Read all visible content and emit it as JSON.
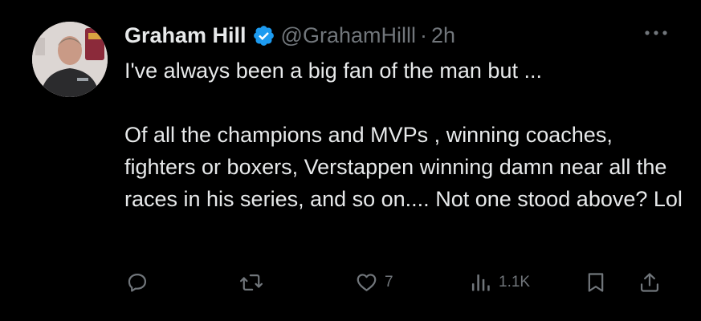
{
  "tweet": {
    "author": {
      "display_name": "Graham Hill",
      "handle": "@GrahamHilll",
      "verified": true
    },
    "separator": "·",
    "timestamp": "2h",
    "text": "I've always been a big fan of the man but ...\n\nOf all the champions and MVPs , winning coaches,  fighters or boxers, Verstappen winning damn near all the races in his series, and so on.... Not one stood above?  Lol",
    "actions": {
      "reply": {
        "icon": "reply-icon",
        "count": ""
      },
      "retweet": {
        "icon": "retweet-icon",
        "count": ""
      },
      "like": {
        "icon": "heart-icon",
        "count": "7"
      },
      "views": {
        "icon": "views-bar-chart-icon",
        "count": "1.1K"
      },
      "bookmark": {
        "icon": "bookmark-icon"
      },
      "share": {
        "icon": "share-icon"
      }
    }
  },
  "colors": {
    "background": "#000000",
    "primary_text": "#e7e9ea",
    "secondary_text": "#71767b",
    "verified_badge": "#1d9bf0"
  }
}
